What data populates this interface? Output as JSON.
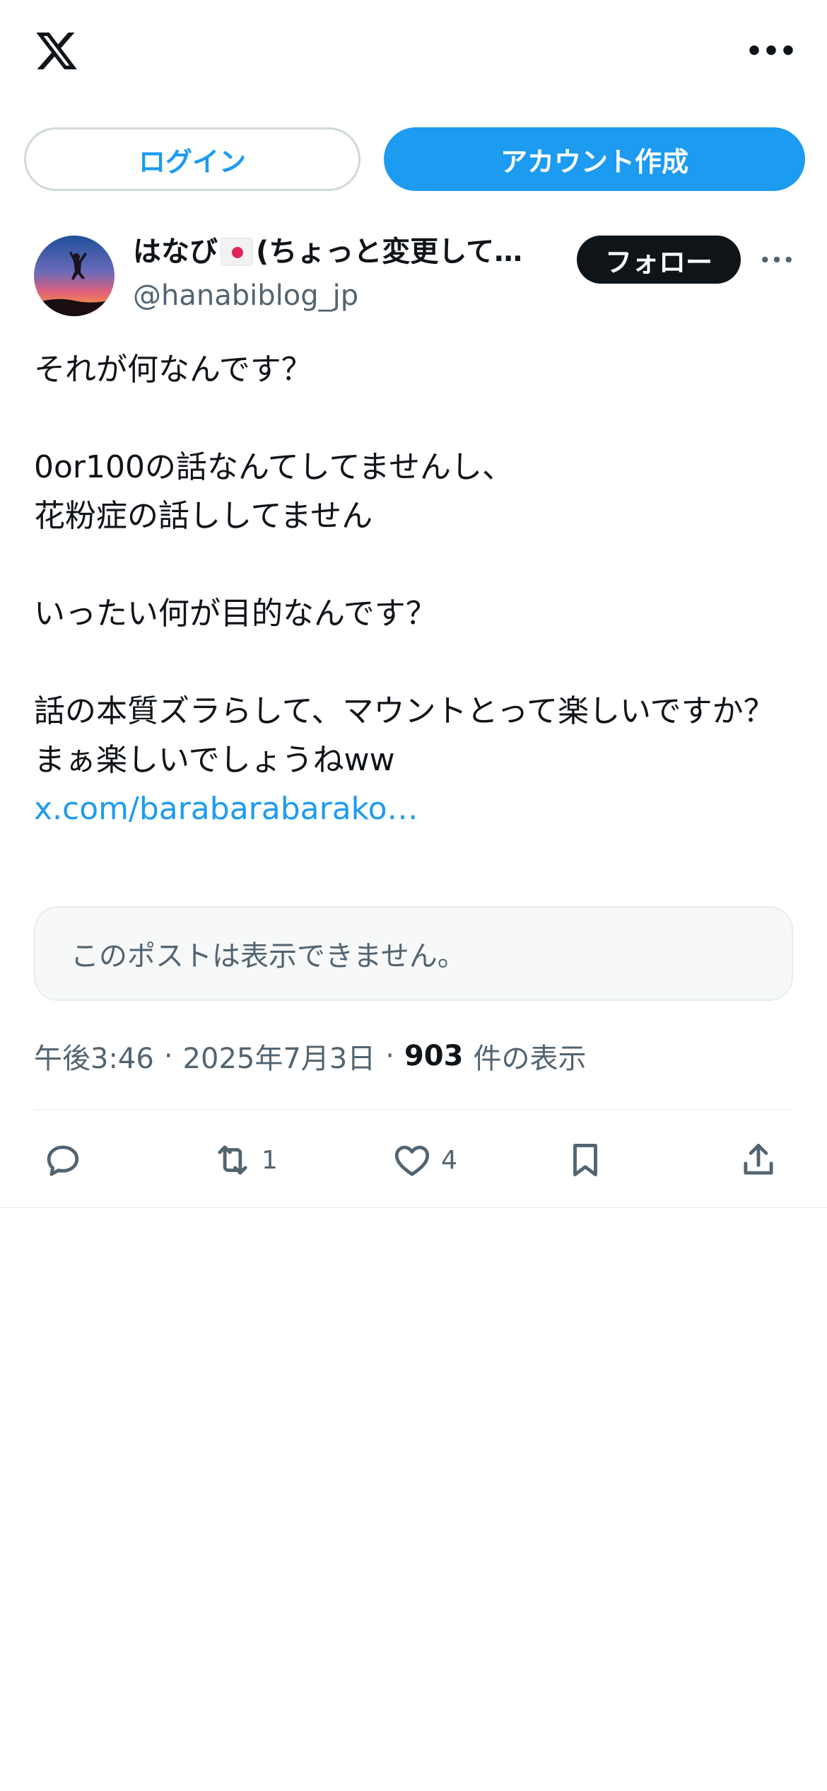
{
  "header": {
    "logo": "x-logo-icon",
    "more": "more-horizontal-icon"
  },
  "auth": {
    "login_label": "ログイン",
    "signup_label": "アカウント作成"
  },
  "post": {
    "author": {
      "name_prefix": "はなび",
      "flag": "japan-flag-icon",
      "name_suffix": "(ちょっと変更して…",
      "handle": "@hanabiblog_jp"
    },
    "follow_label": "フォロー",
    "more": "more-horizontal-icon",
    "text": {
      "line1": "それが何なんです？",
      "line2": "0or100の話なんてしてませんし、",
      "line3": "花粉症の話ししてません",
      "line4": "いったい何が目的なんです？",
      "line5": "話の本質ズラらして、マウントとって楽しいですか？",
      "line6": "まぁ楽しいでしょうねww",
      "link": "x.com/barabarabarako…"
    },
    "quote_unavailable": "このポストは表示できません。",
    "time": "午後3:46",
    "dot": "·",
    "date": "2025年7月3日",
    "views_count": "903",
    "views_label": "件の表示",
    "actions": {
      "reply": {
        "icon": "reply-icon",
        "count": ""
      },
      "repost": {
        "icon": "repost-icon",
        "count": "1"
      },
      "like": {
        "icon": "heart-icon",
        "count": "4"
      },
      "bookmark": {
        "icon": "bookmark-icon",
        "count": ""
      },
      "share": {
        "icon": "share-icon",
        "count": ""
      }
    }
  },
  "colors": {
    "accent": "#1d9bf0",
    "text": "#0f1419",
    "secondary": "#536471",
    "border": "#cfd9de"
  }
}
